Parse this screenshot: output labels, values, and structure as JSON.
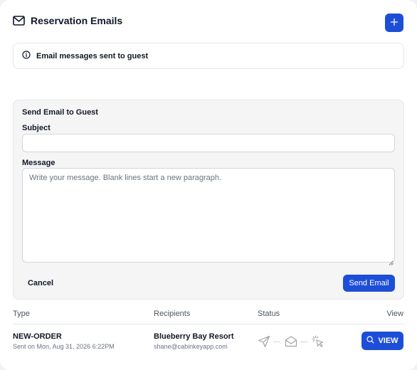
{
  "header": {
    "title": "Reservation Emails",
    "title_icon": "mail-icon",
    "add_icon": "plus-icon"
  },
  "info": {
    "icon": "info-circle-icon",
    "text": "Email messages sent to guest"
  },
  "form": {
    "heading": "Send Email to Guest",
    "subject_label": "Subject",
    "subject_value": "",
    "message_label": "Message",
    "message_placeholder": "Write your message. Blank lines start a new paragraph.",
    "cancel_label": "Cancel",
    "send_label": "Send Email"
  },
  "table": {
    "columns": {
      "type": "Type",
      "recipients": "Recipients",
      "status": "Status",
      "view": "View"
    },
    "rows": [
      {
        "type": "NEW-ORDER",
        "sent": "Sent on Mon, Aug 31, 2026 6:22PM",
        "recipient_name": "Blueberry Bay Resort",
        "recipient_email": "shane@cabinkeyapp.com",
        "status_icons": [
          "send-icon",
          "envelope-open-icon",
          "cursor-click-icon"
        ],
        "view_label": "VIEW",
        "view_icon": "search-icon"
      }
    ]
  },
  "colors": {
    "accent": "#1d4ed8",
    "panel_bg": "#f5f5f6",
    "border": "#e5e7eb",
    "muted_text": "#6b7280",
    "status_icon": "#a3a3a3"
  }
}
